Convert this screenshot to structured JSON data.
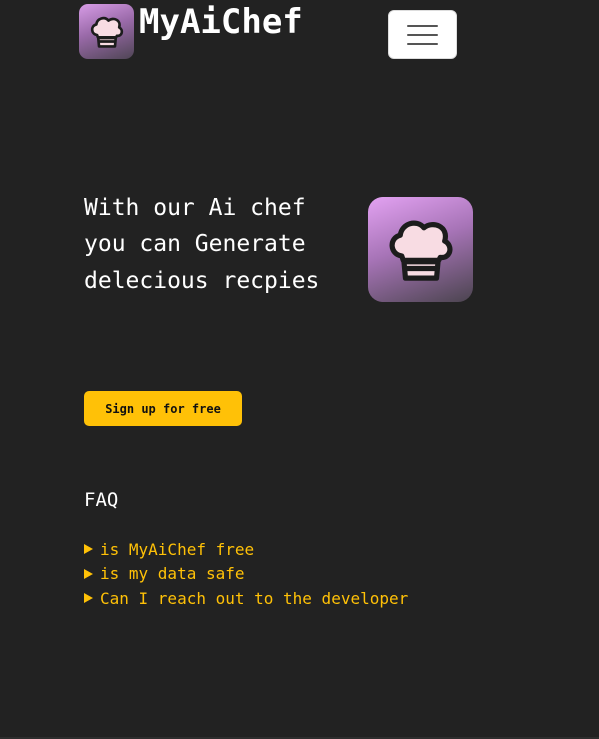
{
  "header": {
    "brand": "MyAiChef",
    "logo_icon": "chef-hat-icon",
    "menu_icon": "hamburger-menu-icon"
  },
  "hero": {
    "title": "With our Ai chef you can Generate delecious recpies",
    "logo_icon": "chef-hat-icon",
    "cta_label": "Sign up for free"
  },
  "faq": {
    "title": "FAQ",
    "items": [
      {
        "label": "is MyAiChef free"
      },
      {
        "label": "is my data safe"
      },
      {
        "label": "Can I reach out to the developer"
      }
    ]
  },
  "colors": {
    "background": "#222222",
    "accent": "#ffc107",
    "text": "#ffffff",
    "logo_gradient_top": "#e3a2f2",
    "logo_gradient_bottom": "#4b444f"
  }
}
